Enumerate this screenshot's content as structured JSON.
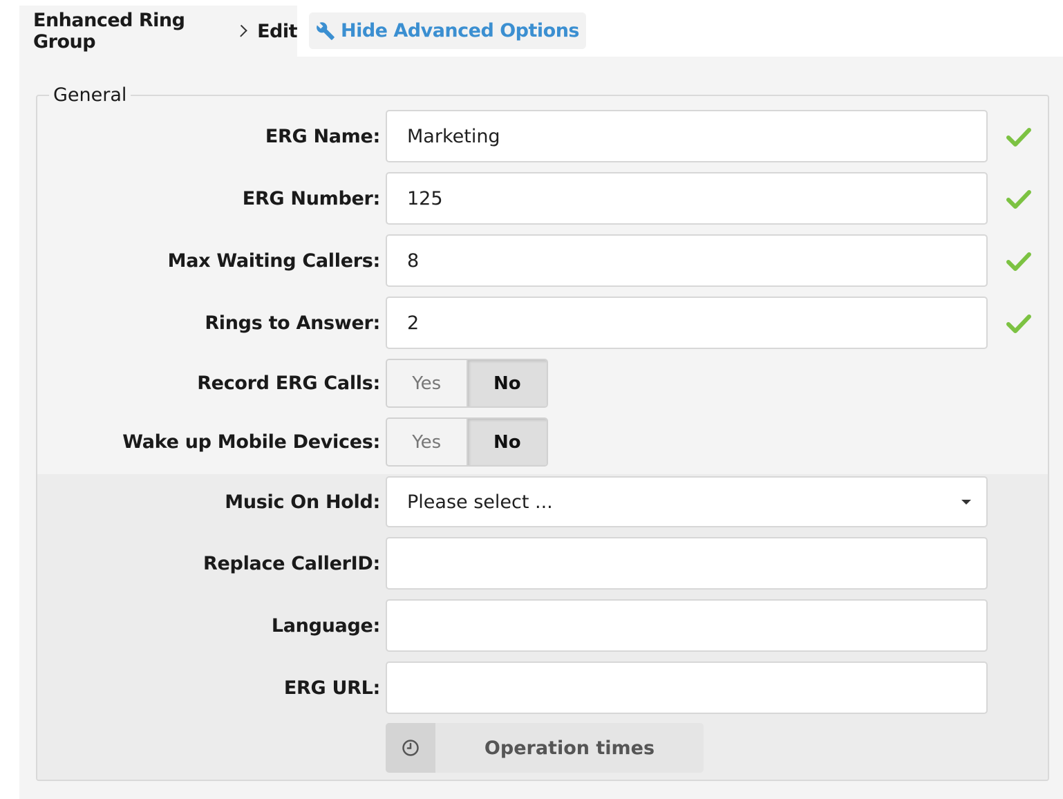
{
  "breadcrumb": {
    "parent": "Enhanced Ring Group",
    "current": "Edit"
  },
  "advanced_toggle": {
    "label": "Hide Advanced Options",
    "icon": "wrench-icon",
    "color": "#3b8fd1"
  },
  "fieldset": {
    "legend": "General"
  },
  "fields": {
    "erg_name": {
      "label": "ERG Name:",
      "value": "Marketing",
      "valid": true
    },
    "erg_number": {
      "label": "ERG Number:",
      "value": "125",
      "valid": true
    },
    "max_waiting": {
      "label": "Max Waiting Callers:",
      "value": "8",
      "valid": true
    },
    "rings_to_answer": {
      "label": "Rings to Answer:",
      "value": "2",
      "valid": true
    },
    "record_calls": {
      "label": "Record ERG Calls:",
      "yes": "Yes",
      "no": "No",
      "selected": "No"
    },
    "wake_mobile": {
      "label": "Wake up Mobile Devices:",
      "yes": "Yes",
      "no": "No",
      "selected": "No"
    },
    "music_on_hold": {
      "label": "Music On Hold:",
      "value": "Please select ..."
    },
    "replace_callerid": {
      "label": "Replace CallerID:",
      "value": ""
    },
    "language": {
      "label": "Language:",
      "value": ""
    },
    "erg_url": {
      "label": "ERG URL:",
      "value": ""
    }
  },
  "operation_times": {
    "label": "Operation times",
    "icon": "clock-icon"
  },
  "colors": {
    "valid_check": "#7cc242"
  }
}
